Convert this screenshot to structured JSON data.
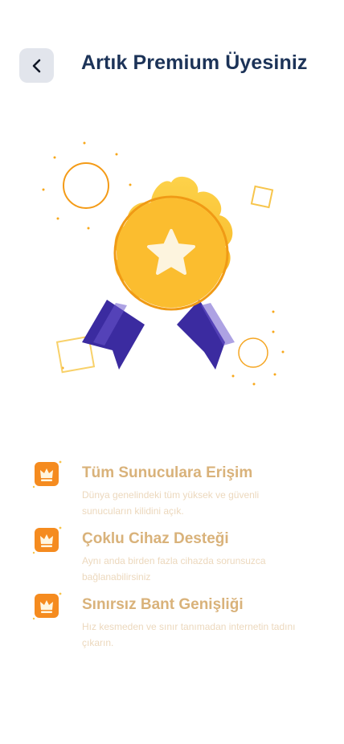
{
  "header": {
    "title": "Artık Premium Üyesiniz",
    "back_icon": "chevron-left-icon"
  },
  "hero": {
    "icon": "premium-badge-star-icon",
    "colors": {
      "badge": "#fbc33a",
      "ring": "#f4a11d",
      "star": "#fdf4de",
      "ribbon": "#3a2a9e",
      "accent": "#f7a81b"
    }
  },
  "features": [
    {
      "icon": "crown-icon",
      "title": "Tüm Sunuculara Erişim",
      "description": "Dünya genelindeki tüm yüksek ve güvenli sunucuların kilidini açık."
    },
    {
      "icon": "crown-icon",
      "title": "Çoklu Cihaz Desteği",
      "description": "Aynı anda birden fazla cihazda sorunsuzca bağlanabilirsiniz"
    },
    {
      "icon": "crown-icon",
      "title": "Sınırsız Bant Genişliği",
      "description": "Hız kesmeden ve sınır tanımadan internetin tadını çıkarın."
    }
  ],
  "colors": {
    "title": "#1c3358",
    "feature_title": "#d9b27a",
    "feature_desc": "#ecd8bd",
    "crown_tile": "#f58b1f"
  }
}
